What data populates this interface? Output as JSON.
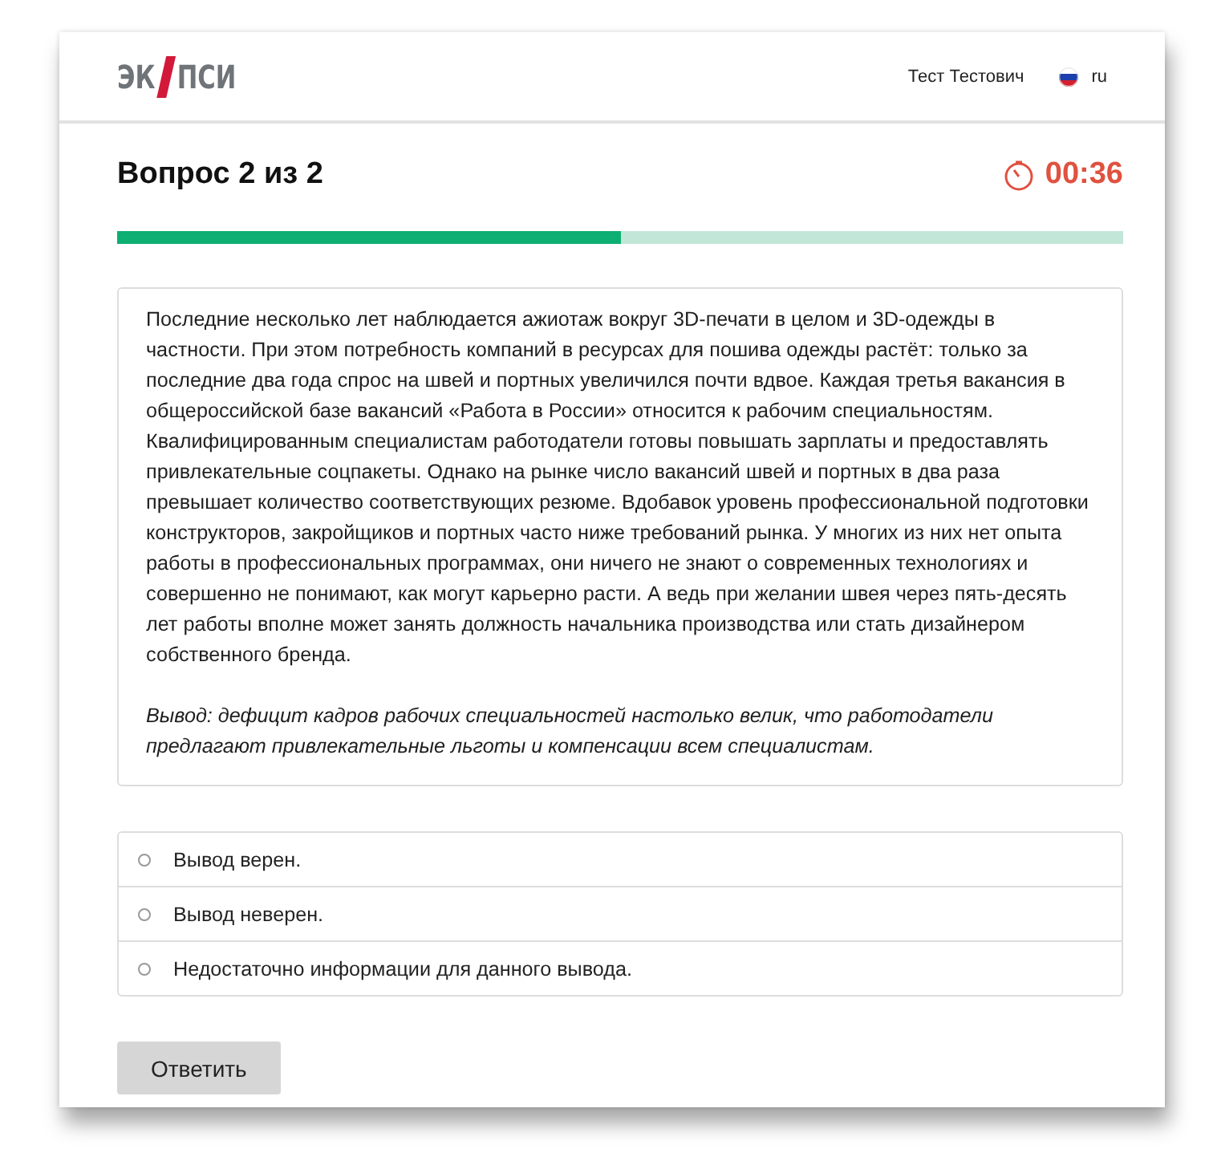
{
  "header": {
    "logo": {
      "left": "ЭК",
      "right": "ПСИ"
    },
    "user_name": "Тест Тестович",
    "language": "ru"
  },
  "question": {
    "title": "Вопрос 2 из 2",
    "timer": "00:36",
    "progress": {
      "level": 0.5
    }
  },
  "passage": {
    "paragraphs": [
      "Последние несколько лет наблюдается ажиотаж вокруг 3D-печати в целом и 3D-одежды в частности. При этом потребность компаний в ресурсах для пошива одежды растёт: только за последние два года спрос на швей и портных увеличился почти вдвое. Каждая третья вакансия в общероссийской базе вакансий «Работа в России» относится к рабочим специальностям. Квалифицированным специалистам работодатели готовы повышать зарплаты и предоставлять привлекательные соцпакеты. Однако на рынке число вакансий швей и портных в два раза превышает количество соответствующих резюме. Вдобавок уровень профессиональной подготовки конструкторов, закройщиков и портных часто ниже требований рынка. У многих из них нет опыта работы в профессиональных программах, они ничего не знают о современных технологиях и совершенно не понимают, как могут карьерно расти. А ведь при желании швея через пять-десять лет работы вполне может занять должность начальника производства или стать дизайнером собственного бренда."
    ],
    "conclusion": "Вывод: дефицит кадров рабочих специальностей настолько велик, что работодатели предлагают привлекательные льготы и компенсации всем специалистам."
  },
  "options": [
    {
      "label": "Вывод верен.",
      "selected": false
    },
    {
      "label": "Вывод неверен.",
      "selected": false
    },
    {
      "label": "Недостаточно информации для данного вывода.",
      "selected": false
    }
  ],
  "submit_button": "Ответить"
}
